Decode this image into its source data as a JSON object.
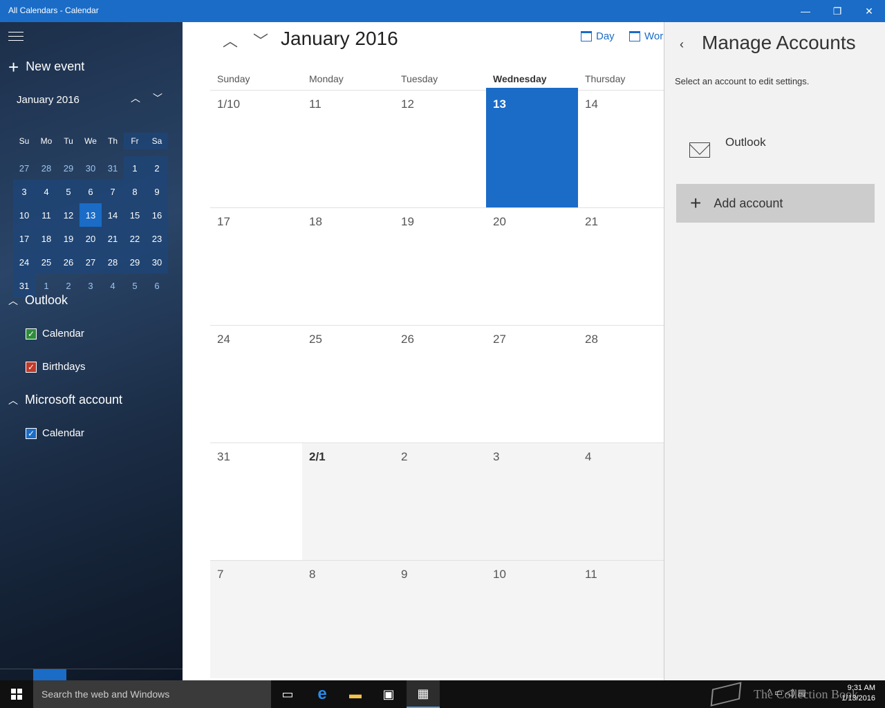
{
  "window": {
    "title": "All Calendars - Calendar",
    "minimize": "—",
    "restore": "❐",
    "close": "✕"
  },
  "sidebar": {
    "new_event": "New event",
    "mini_calendar": {
      "title": "January 2016",
      "weekday_heads": [
        "Su",
        "Mo",
        "Tu",
        "We",
        "Th",
        "Fr",
        "Sa"
      ],
      "weeks": [
        [
          "27",
          "28",
          "29",
          "30",
          "31",
          "1",
          "2"
        ],
        [
          "3",
          "4",
          "5",
          "6",
          "7",
          "8",
          "9"
        ],
        [
          "10",
          "11",
          "12",
          "13",
          "14",
          "15",
          "16"
        ],
        [
          "17",
          "18",
          "19",
          "20",
          "21",
          "22",
          "23"
        ],
        [
          "24",
          "25",
          "26",
          "27",
          "28",
          "29",
          "30"
        ],
        [
          "31",
          "1",
          "2",
          "3",
          "4",
          "5",
          "6"
        ]
      ]
    },
    "groups": [
      {
        "name": "Outlook",
        "calendars": [
          {
            "name": "Calendar",
            "color": "#2e8b3a"
          },
          {
            "name": "Birthdays",
            "color": "#c0392b"
          }
        ]
      },
      {
        "name": "Microsoft account",
        "calendars": [
          {
            "name": "Calendar",
            "color": "#1a6cc7"
          }
        ]
      }
    ],
    "bottom_icons": [
      "mail-icon",
      "calendar-icon",
      "feedback-smiley-icon",
      "gear-icon"
    ]
  },
  "main": {
    "title": "January 2016",
    "views": {
      "day": "Day",
      "work_week": "Wor"
    },
    "day_headers": [
      "Sunday",
      "Monday",
      "Tuesday",
      "Wednesday",
      "Thursday"
    ],
    "weeks": [
      [
        "1/10",
        "11",
        "12",
        "13",
        "14"
      ],
      [
        "17",
        "18",
        "19",
        "20",
        "21"
      ],
      [
        "24",
        "25",
        "26",
        "27",
        "28"
      ],
      [
        "31",
        "2/1",
        "2",
        "3",
        "4"
      ],
      [
        "7",
        "8",
        "9",
        "10",
        "11"
      ]
    ],
    "today": "13"
  },
  "panel": {
    "title": "Manage Accounts",
    "subtitle": "Select an account to edit settings.",
    "account": "Outlook",
    "add_account": "Add account"
  },
  "taskbar": {
    "search_placeholder": "Search the web and Windows",
    "watermark": "The Collection Book",
    "time": "9:31 AM",
    "date": "1/13/2016"
  },
  "colors": {
    "accent": "#1a6cc7",
    "taskbar": "#101010",
    "panel": "#f2f2f2"
  }
}
